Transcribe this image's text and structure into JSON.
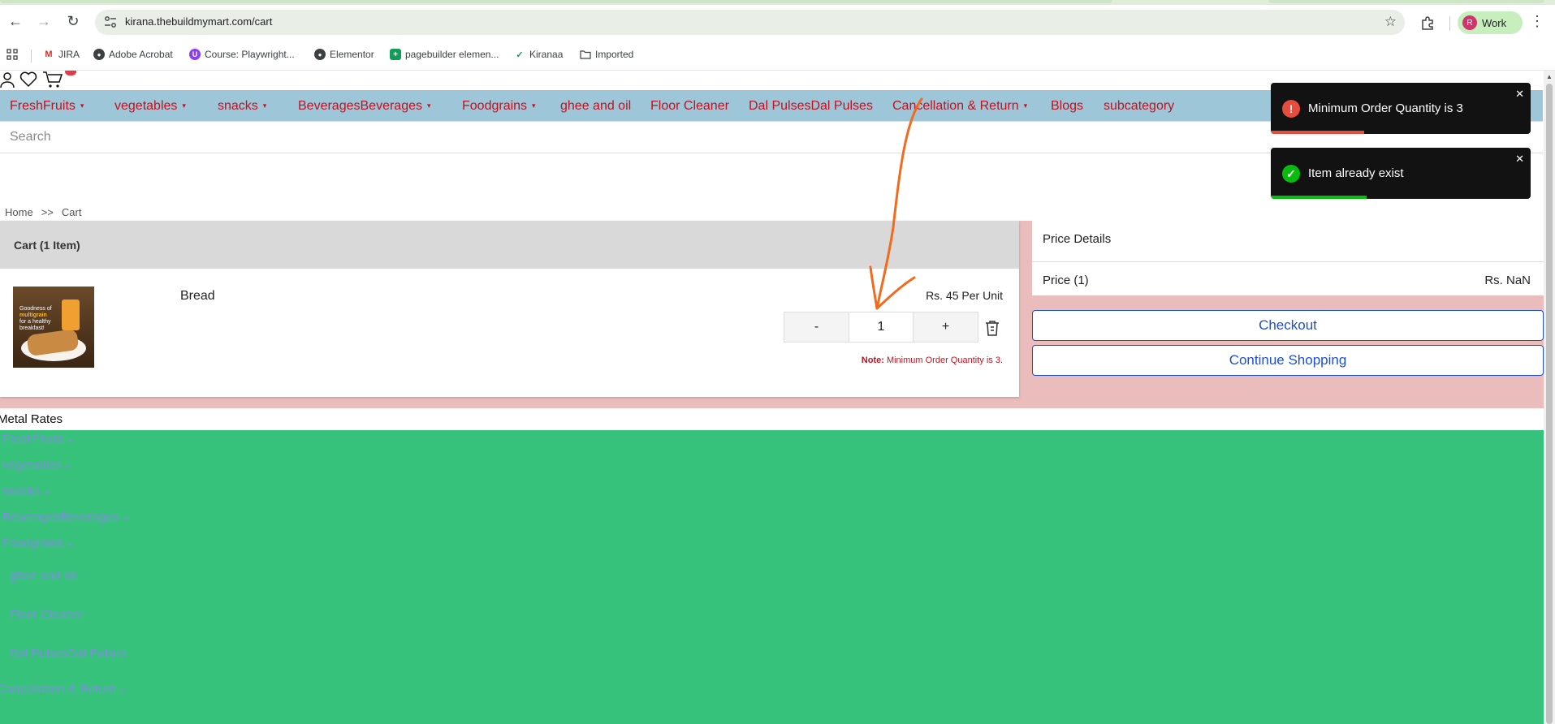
{
  "browser": {
    "url": "kirana.thebuildmymart.com/cart",
    "profile_initial": "R",
    "profile_name": "Work",
    "bookmarks": [
      {
        "label": "JIRA",
        "icon": "gmail-icon"
      },
      {
        "label": "Adobe Acrobat",
        "icon": "globe-icon"
      },
      {
        "label": "Course: Playwright...",
        "icon": "course-icon"
      },
      {
        "label": "Elementor",
        "icon": "globe-icon"
      },
      {
        "label": "pagebuilder elemen...",
        "icon": "sheets-icon"
      },
      {
        "label": "Kiranaa",
        "icon": "check-icon"
      },
      {
        "label": "Imported",
        "icon": "folder-icon"
      }
    ]
  },
  "nav": {
    "items": [
      {
        "label": "FreshFruits",
        "caret": true
      },
      {
        "label": "vegetables",
        "caret": true
      },
      {
        "label": "snacks",
        "caret": true
      },
      {
        "label": "BeveragesBeverages",
        "caret": true
      },
      {
        "label": "Foodgrains",
        "caret": true
      },
      {
        "label": "ghee and oil",
        "caret": false
      },
      {
        "label": "Floor Cleaner",
        "caret": false
      },
      {
        "label": "Dal PulsesDal Pulses",
        "caret": false
      },
      {
        "label": "Cancellation & Return",
        "caret": true
      },
      {
        "label": "Blogs",
        "caret": false
      },
      {
        "label": "subcategory",
        "caret": false
      }
    ],
    "caret_glyph": "▾"
  },
  "search": {
    "placeholder": "Search"
  },
  "breadcrumb": {
    "home": "Home",
    "sep": ">>",
    "current": "Cart"
  },
  "cart": {
    "header": "Cart (1 Item)",
    "product": {
      "name": "Bread",
      "unit_price": "Rs. 45 Per Unit",
      "image_text": "Goodness of multigrain for a healthy breakfast",
      "quantity": "1",
      "minus_label": "-",
      "plus_label": "+",
      "note_label": "Note:",
      "note_text": "Minimum Order Quantity is 3."
    }
  },
  "price_details": {
    "title": "Price Details",
    "row_label": "Price (1)",
    "row_amount": "Rs. NaN",
    "checkout_label": "Checkout",
    "continue_label": "Continue Shopping"
  },
  "footer": {
    "metal_rates": "Metal Rates",
    "items": [
      {
        "label": "FreshFruits",
        "caret": true
      },
      {
        "label": "vegetables",
        "caret": true
      },
      {
        "label": "snacks",
        "caret": true
      },
      {
        "label": "BeveragesBeverages",
        "caret": true
      },
      {
        "label": "Foodgrains",
        "caret": true
      },
      {
        "label": "ghee and oil",
        "caret": false
      },
      {
        "label": "Floor Cleaner",
        "caret": false
      },
      {
        "label": "Dal PulsesDal Pulses",
        "caret": false
      },
      {
        "label": "Cancellation & Return",
        "caret": true
      }
    ]
  },
  "toasts": [
    {
      "message": "Minimum Order Quantity is 3",
      "type": "error",
      "icon": "exclamation-icon",
      "color": "#e74c3c",
      "progress": 0.3,
      "close": "✕"
    },
    {
      "message": "Item already exist",
      "type": "success",
      "icon": "check-icon",
      "color": "#07bc0c",
      "progress": 0.3,
      "close": "✕"
    }
  ],
  "colors": {
    "nav_bg": "#9dc6d8",
    "nav_text": "#c1121f",
    "cart_bg": "#eabcbc",
    "footer_bg": "#37c27c",
    "button_accent": "#1d4ed8",
    "annotation": "#f26a1b"
  }
}
